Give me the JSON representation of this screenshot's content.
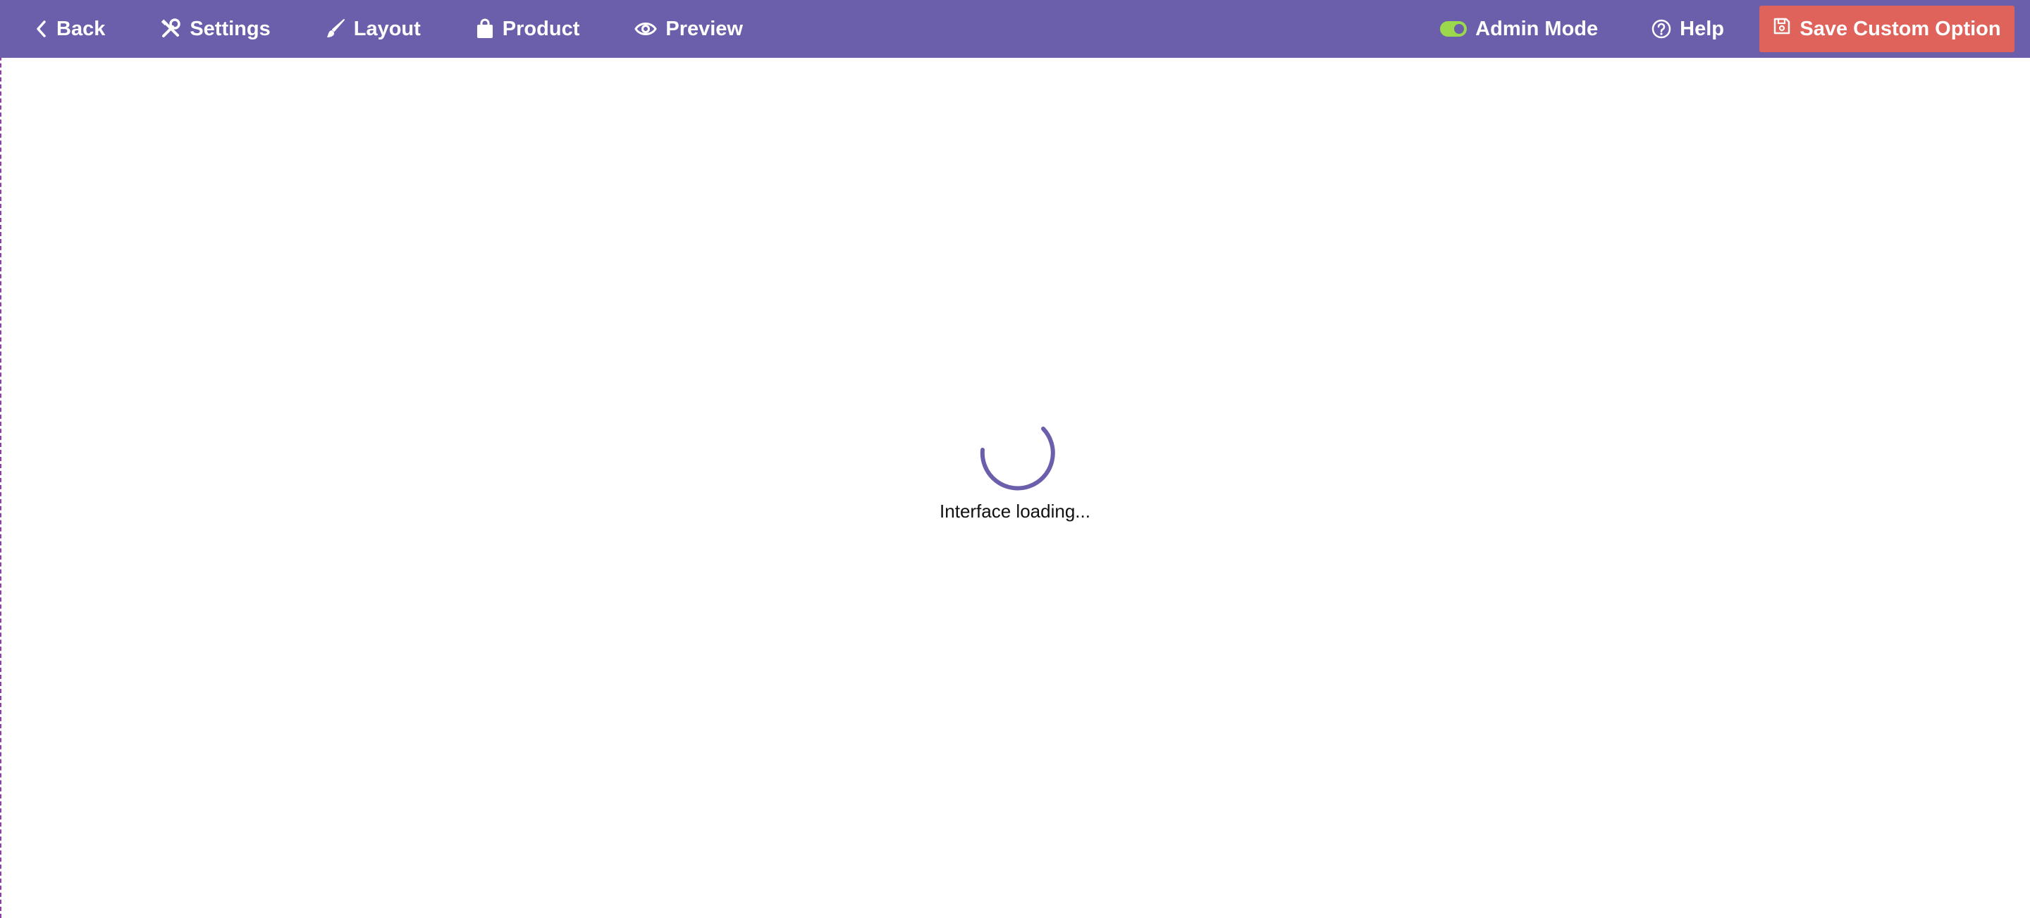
{
  "toolbar": {
    "back": "Back",
    "settings": "Settings",
    "layout": "Layout",
    "product": "Product",
    "preview": "Preview",
    "admin_mode": "Admin Mode",
    "help": "Help",
    "save": "Save Custom Option"
  },
  "icons": {
    "back": "chevron-left-icon",
    "settings": "tools-icon",
    "layout": "paintbrush-icon",
    "product": "shopping-bag-icon",
    "preview": "eye-icon",
    "admin_mode": "toggle-on-icon",
    "help": "question-circle-icon",
    "save": "floppy-disk-icon"
  },
  "colors": {
    "topbar": "#6b5eab",
    "save_button": "#e0635b",
    "toggle_on": "#9cd84b",
    "spinner": "#6b5eab"
  },
  "main": {
    "loading_text": "Interface loading..."
  }
}
